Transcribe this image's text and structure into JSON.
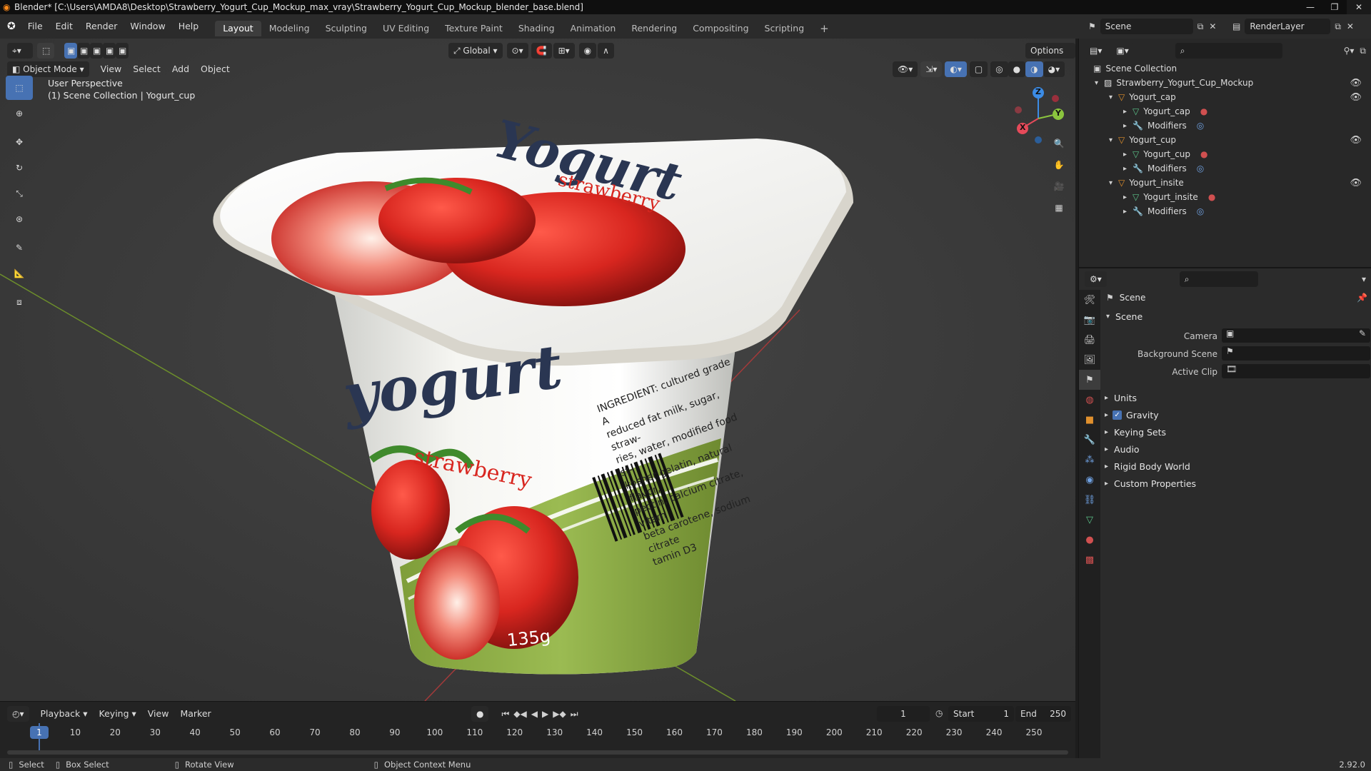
{
  "window": {
    "title": "Blender* [C:\\Users\\AMDA8\\Desktop\\Strawberry_Yogurt_Cup_Mockup_max_vray\\Strawberry_Yogurt_Cup_Mockup_blender_base.blend]"
  },
  "menu": [
    "File",
    "Edit",
    "Render",
    "Window",
    "Help"
  ],
  "workspaces": [
    "Layout",
    "Modeling",
    "Sculpting",
    "UV Editing",
    "Texture Paint",
    "Shading",
    "Animation",
    "Rendering",
    "Compositing",
    "Scripting"
  ],
  "scene_selector": {
    "value": "Scene"
  },
  "renderlayer_selector": {
    "value": "RenderLayer"
  },
  "viewport": {
    "mode": "Object Mode",
    "menus": [
      "View",
      "Select",
      "Add",
      "Object"
    ],
    "orientation": "Global",
    "options_label": "Options",
    "perspective_label": "User Perspective",
    "collection_label": "(1) Scene Collection | Yogurt_cup",
    "gizmo": {
      "x": "X",
      "y": "Y",
      "z": "Z"
    }
  },
  "product": {
    "lid_brand": "Yogurt",
    "lid_flavor": "strawberry",
    "cup_brand": "yogurt",
    "cup_flavor": "strawberry",
    "ingredients": [
      "INGREDIENT: cultured grade A",
      "reduced fat milk, sugar, straw-",
      "ries, water, modified food st-",
      "kosher gelatin, natural flavor,",
      "pectin, calcium citrate, vitam",
      "beta carotene, sodium citrate",
      "tamin D3"
    ],
    "weight": "135g"
  },
  "timeline": {
    "menus": [
      "Playback",
      "Keying",
      "View",
      "Marker"
    ],
    "current_frame": "1",
    "start_label": "Start",
    "start_value": "1",
    "end_label": "End",
    "end_value": "250",
    "ticks": [
      "1",
      "10",
      "20",
      "30",
      "40",
      "50",
      "60",
      "70",
      "80",
      "90",
      "100",
      "110",
      "120",
      "130",
      "140",
      "150",
      "160",
      "170",
      "180",
      "190",
      "200",
      "210",
      "220",
      "230",
      "240",
      "250"
    ]
  },
  "statusbar": {
    "select": "Select",
    "box_select": "Box Select",
    "rotate": "Rotate View",
    "context": "Object Context Menu",
    "version": "2.92.0"
  },
  "outliner": {
    "root": "Scene Collection",
    "items": [
      {
        "label": "Strawberry_Yogurt_Cup_Mockup",
        "type": "collection"
      },
      {
        "label": "Yogurt_cap",
        "type": "object"
      },
      {
        "label": "Yogurt_cap",
        "type": "mesh"
      },
      {
        "label": "Modifiers",
        "type": "modifiers"
      },
      {
        "label": "Yogurt_cup",
        "type": "object"
      },
      {
        "label": "Yogurt_cup",
        "type": "mesh"
      },
      {
        "label": "Modifiers",
        "type": "modifiers"
      },
      {
        "label": "Yogurt_insite",
        "type": "object"
      },
      {
        "label": "Yogurt_insite",
        "type": "mesh"
      },
      {
        "label": "Modifiers",
        "type": "modifiers"
      }
    ]
  },
  "properties": {
    "context": "Scene",
    "panel": "Scene",
    "fields": [
      {
        "label": "Camera"
      },
      {
        "label": "Background Scene"
      },
      {
        "label": "Active Clip"
      }
    ],
    "subpanels": [
      "Units",
      "Gravity",
      "Keying Sets",
      "Audio",
      "Rigid Body World",
      "Custom Properties"
    ],
    "gravity_checked": true
  },
  "colors": {
    "accent": "#4772b3",
    "x_axis": "#e64a5a",
    "y_axis": "#8bc43e",
    "z_axis": "#3c8ce6",
    "object_orange": "#e0902d",
    "mesh_green": "#5cc48a",
    "material_red": "#d05050"
  }
}
